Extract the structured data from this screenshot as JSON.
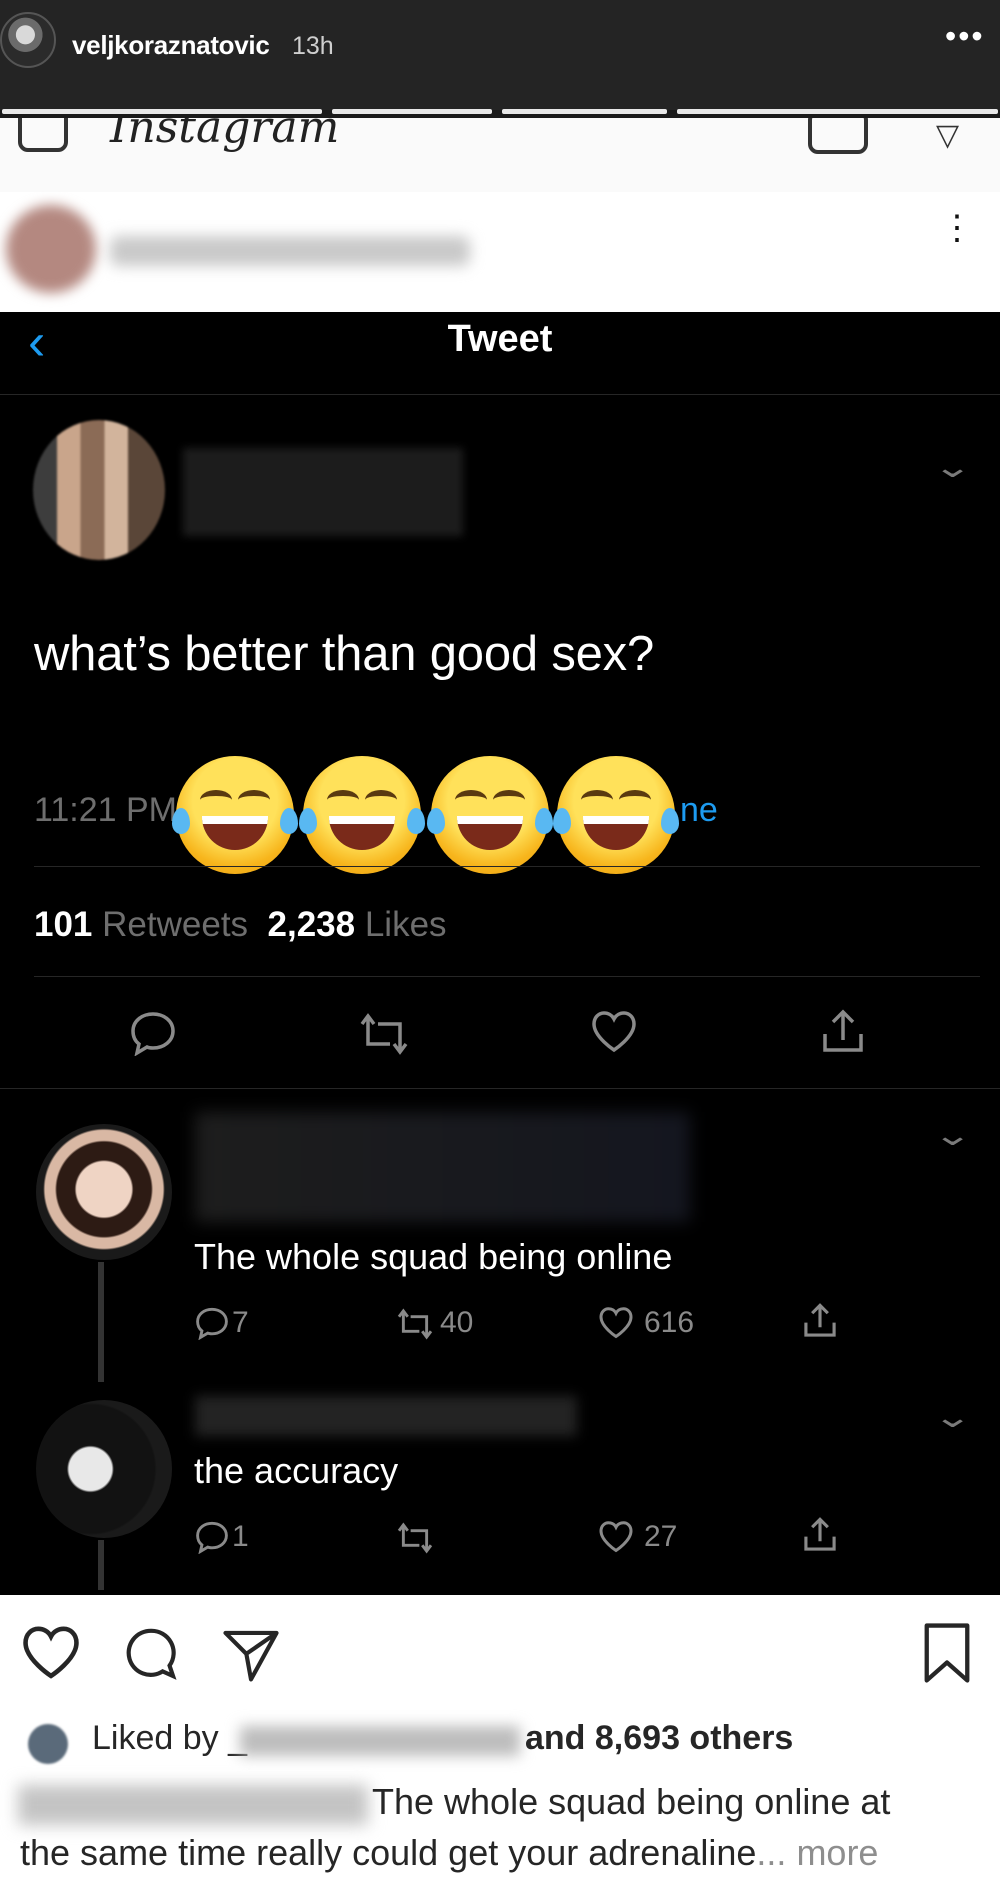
{
  "story": {
    "username": "veljkoraznatovic",
    "time": "13h",
    "more_glyph": "•••"
  },
  "instagram_header": {
    "logo_text": "Instagram",
    "menu_glyph": "⋮"
  },
  "tweet": {
    "header_title": "Tweet",
    "back_glyph": "‹",
    "chevron_glyph": "⌄",
    "text": "what’s better than good sex?",
    "timestamp": "11:21 PM",
    "app_label": "ne",
    "retweets_count": "101",
    "retweets_label": "Retweets",
    "likes_count": "2,238",
    "likes_label": "Likes",
    "emoji_overlay": [
      "face-with-tears-of-joy",
      "face-with-tears-of-joy",
      "face-with-tears-of-joy",
      "face-with-tears-of-joy"
    ]
  },
  "replies": [
    {
      "text": "The whole squad being online",
      "replies": "7",
      "retweets": "40",
      "likes": "616"
    },
    {
      "text": "the accuracy",
      "replies": "1",
      "retweets": "",
      "likes": "27"
    }
  ],
  "post_footer": {
    "liked_by_prefix": "Liked by _",
    "liked_by_suffix": "and 8,693 others",
    "caption_line1": "The whole squad being online at",
    "caption_line2": "the same time really could get your adrenaline",
    "caption_ellipsis": "...",
    "more_label": "more"
  },
  "colors": {
    "twitter_blue": "#1d9bf0",
    "tweet_background": "#000000",
    "story_background": "#242424"
  }
}
